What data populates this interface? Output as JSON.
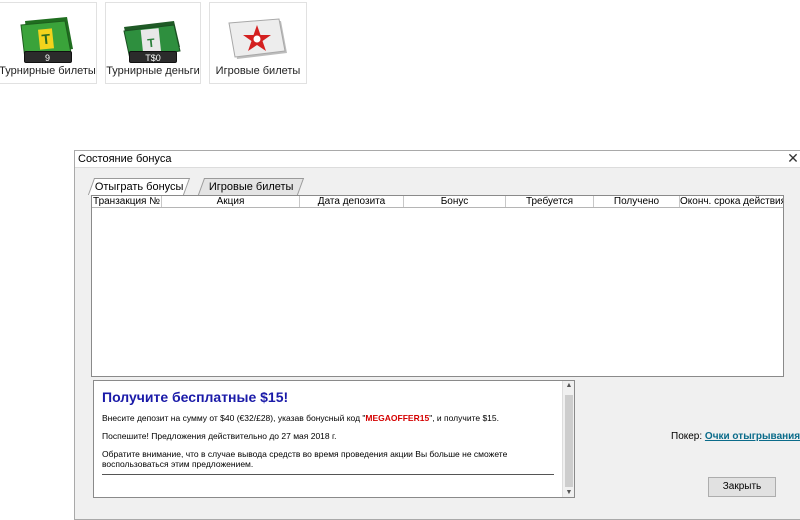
{
  "cards": [
    {
      "label": "Турнирные билеты",
      "count": "9",
      "icon": "tournament-ticket-icon",
      "color": "#2e8b2e"
    },
    {
      "label": "Турнирные деньги",
      "count": "T$0",
      "icon": "tournament-money-icon",
      "color": "#2a7f3a"
    },
    {
      "label": "Игровые билеты",
      "count": "",
      "icon": "game-ticket-icon",
      "color": "#d42020"
    }
  ],
  "dialog": {
    "title": "Состояние бонуса",
    "close_glyph": "✕",
    "tabs": [
      {
        "label": "Отыграть бонусы",
        "active": true
      },
      {
        "label": "Игровые билеты",
        "active": false
      }
    ],
    "columns": [
      "Транзакция №",
      "Акция",
      "Дата депозита",
      "Бонус",
      "Требуется",
      "Получено",
      "Оконч. срока действия"
    ],
    "promo": {
      "title": "Получите бесплатные $15!",
      "line1_before": "Внесите депозит на сумму от $40 (€32/£28), указав бонусный код \"",
      "code": "MEGAOFFER15",
      "line1_after": "\", и получите $15.",
      "line2": "Поспешите! Предложения действительно до 27 мая 2018 г.",
      "line3": "Обратите внимание, что в случае вывода средств во время проведения акции Вы больше не сможете воспользоваться этим предложением."
    },
    "poker_label": "Покер:",
    "poker_link": "Очки отыгрывания",
    "close_button": "Закрыть"
  }
}
